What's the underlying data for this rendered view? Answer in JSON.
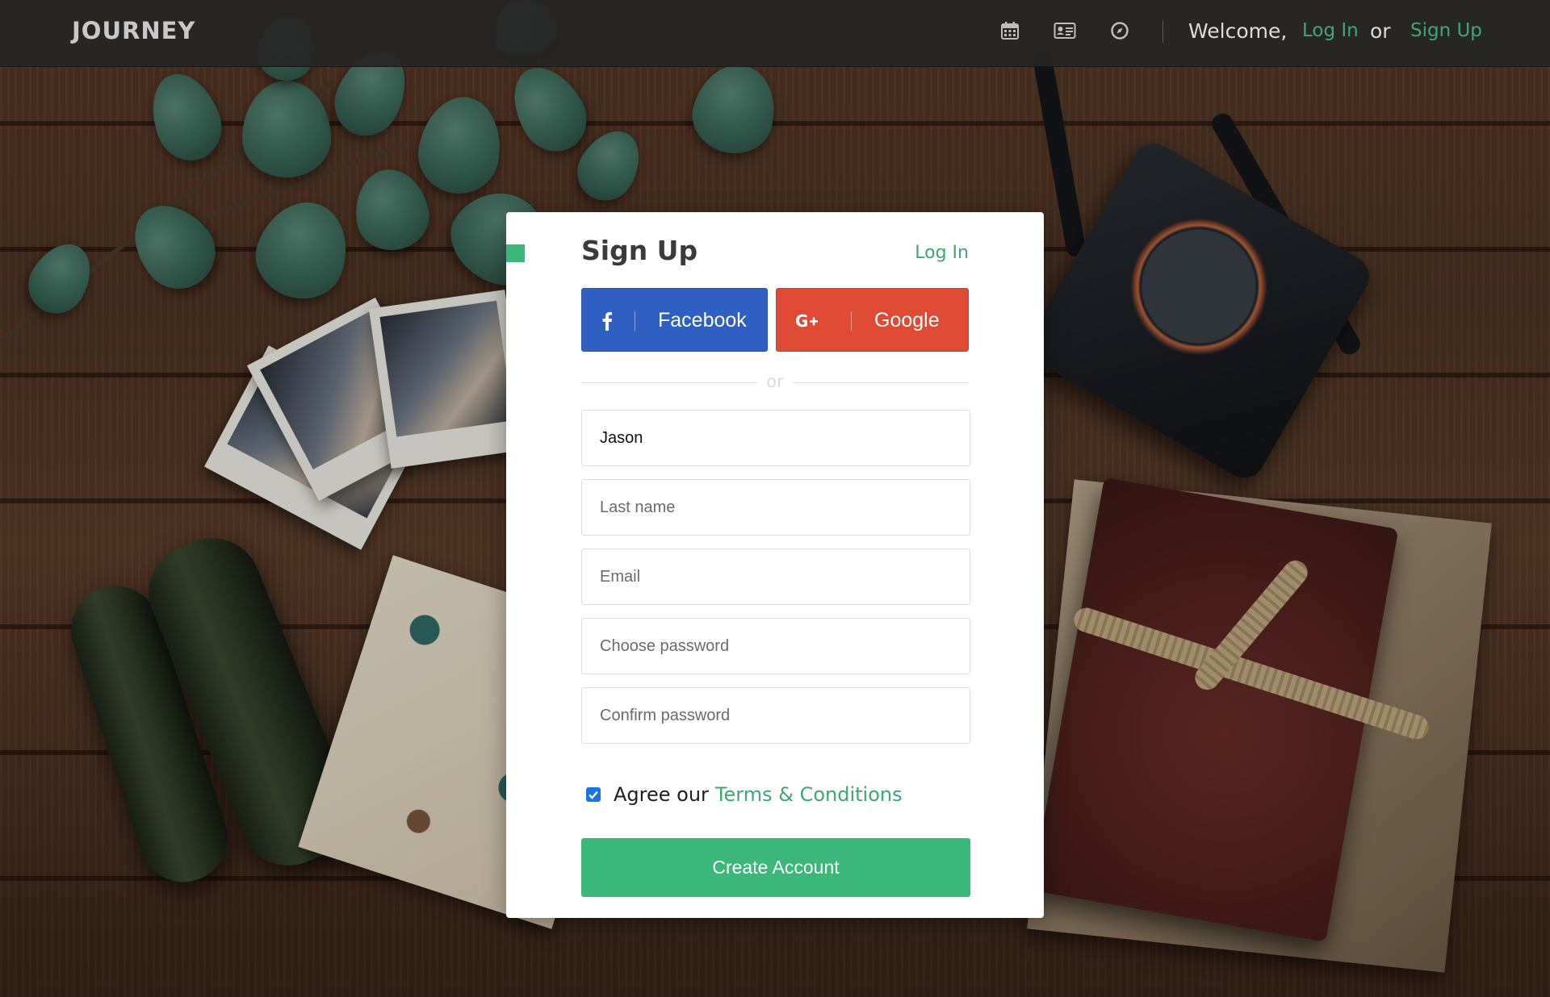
{
  "navbar": {
    "brand": "JOURNEY",
    "icons": [
      "calendar-icon",
      "id-card-icon",
      "compass-icon"
    ],
    "welcome": "Welcome,",
    "login_link": "Log In",
    "or_text": "or",
    "signup_link": "Sign Up"
  },
  "signup": {
    "title": "Sign Up",
    "login_link": "Log In",
    "facebook_label": "Facebook",
    "google_label": "Google",
    "or_text": "or",
    "fields": {
      "first_name_value": "Jason",
      "last_name_placeholder": "Last name",
      "email_placeholder": "Email",
      "password_placeholder": "Choose password",
      "confirm_placeholder": "Confirm password"
    },
    "agree_text": "Agree our",
    "terms_link": "Terms & Conditions",
    "agree_checked": true,
    "submit_label": "Create Account"
  },
  "colors": {
    "accent": "#3bb77a",
    "link": "#3fa774",
    "facebook": "#2f5fc2",
    "google": "#de4a33",
    "navbar": "#262626"
  }
}
